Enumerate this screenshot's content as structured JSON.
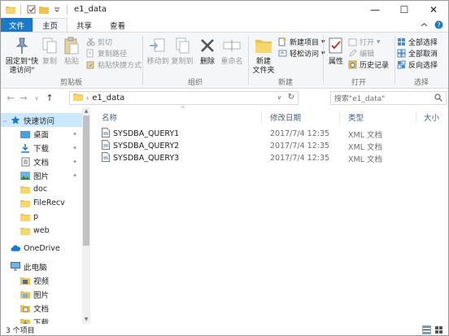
{
  "window": {
    "title": "e1_data",
    "minimize": "—",
    "maximize": "☐",
    "close": "✕"
  },
  "tabs": [
    {
      "label": "文件"
    },
    {
      "label": "主页"
    },
    {
      "label": "共享"
    },
    {
      "label": "查看"
    }
  ],
  "ribbon": {
    "clipboard": {
      "label": "剪贴板",
      "pin_to_quick_access": "固定到\"快\n速访问\"",
      "copy": "复制",
      "paste": "粘贴",
      "cut": "剪切",
      "copy_path": "复制路径",
      "paste_shortcut": "粘贴快捷方式"
    },
    "organize": {
      "label": "组织",
      "move_to": "移动到",
      "copy_to": "复制到",
      "delete": "删除",
      "rename": "重命名"
    },
    "new": {
      "label": "新建",
      "new_folder": "新建\n文件夹",
      "new_item": "新建项目",
      "easy_access": "轻松访问"
    },
    "open": {
      "label": "打开",
      "properties": "属性",
      "open": "打开",
      "edit": "编辑",
      "history": "历史记录"
    },
    "select": {
      "label": "选择",
      "select_all": "全部选择",
      "select_none": "全部取消",
      "invert_selection": "反向选择"
    }
  },
  "address": {
    "path": "e1_data",
    "search_placeholder": "搜索\"e1_data\""
  },
  "nav": {
    "quick_access": "快速访问",
    "items": [
      {
        "label": "桌面"
      },
      {
        "label": "下载"
      },
      {
        "label": "文档"
      },
      {
        "label": "图片"
      },
      {
        "label": "doc"
      },
      {
        "label": "FileRecv"
      },
      {
        "label": "p"
      },
      {
        "label": "web"
      }
    ],
    "onedrive": "OneDrive",
    "this_pc": "此电脑",
    "pc_items": [
      {
        "label": "视频"
      },
      {
        "label": "图片"
      },
      {
        "label": "文档"
      },
      {
        "label": "下载"
      }
    ]
  },
  "columns": {
    "name": "名称",
    "date": "修改日期",
    "type": "类型",
    "size": "大小"
  },
  "files": [
    {
      "name": "SYSDBA_QUERY1",
      "date": "2017/7/4 12:35",
      "type": "XML 文档"
    },
    {
      "name": "SYSDBA_QUERY2",
      "date": "2017/7/4 12:35",
      "type": "XML 文档"
    },
    {
      "name": "SYSDBA_QUERY3",
      "date": "2017/7/4 12:35",
      "type": "XML 文档"
    }
  ],
  "status": {
    "count": "3 个项目"
  },
  "colors": {
    "file_tab": "#1979ca",
    "selection": "#cce8ff",
    "folder": "#f0c44c"
  }
}
